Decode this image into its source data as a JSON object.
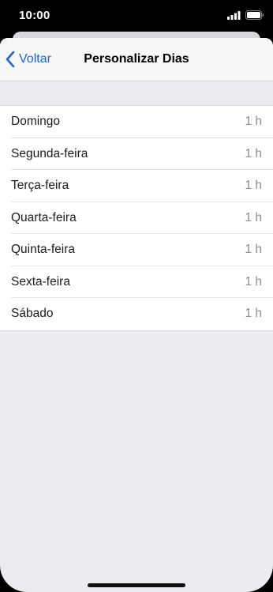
{
  "status_bar": {
    "time": "10:00"
  },
  "nav": {
    "back_label": "Voltar",
    "title": "Personalizar Dias"
  },
  "days": [
    {
      "label": "Domingo",
      "value": "1 h"
    },
    {
      "label": "Segunda-feira",
      "value": "1 h"
    },
    {
      "label": "Terça-feira",
      "value": "1 h"
    },
    {
      "label": "Quarta-feira",
      "value": "1 h"
    },
    {
      "label": "Quinta-feira",
      "value": "1 h"
    },
    {
      "label": "Sexta-feira",
      "value": "1 h"
    },
    {
      "label": "Sábado",
      "value": "1 h"
    }
  ],
  "colors": {
    "accent": "#1f64d6",
    "background": "#ebebf0",
    "secondary_text": "#8e8e93"
  },
  "icons": {
    "back": "chevron-left-icon",
    "signal": "cellular-signal-icon",
    "battery": "battery-icon"
  }
}
